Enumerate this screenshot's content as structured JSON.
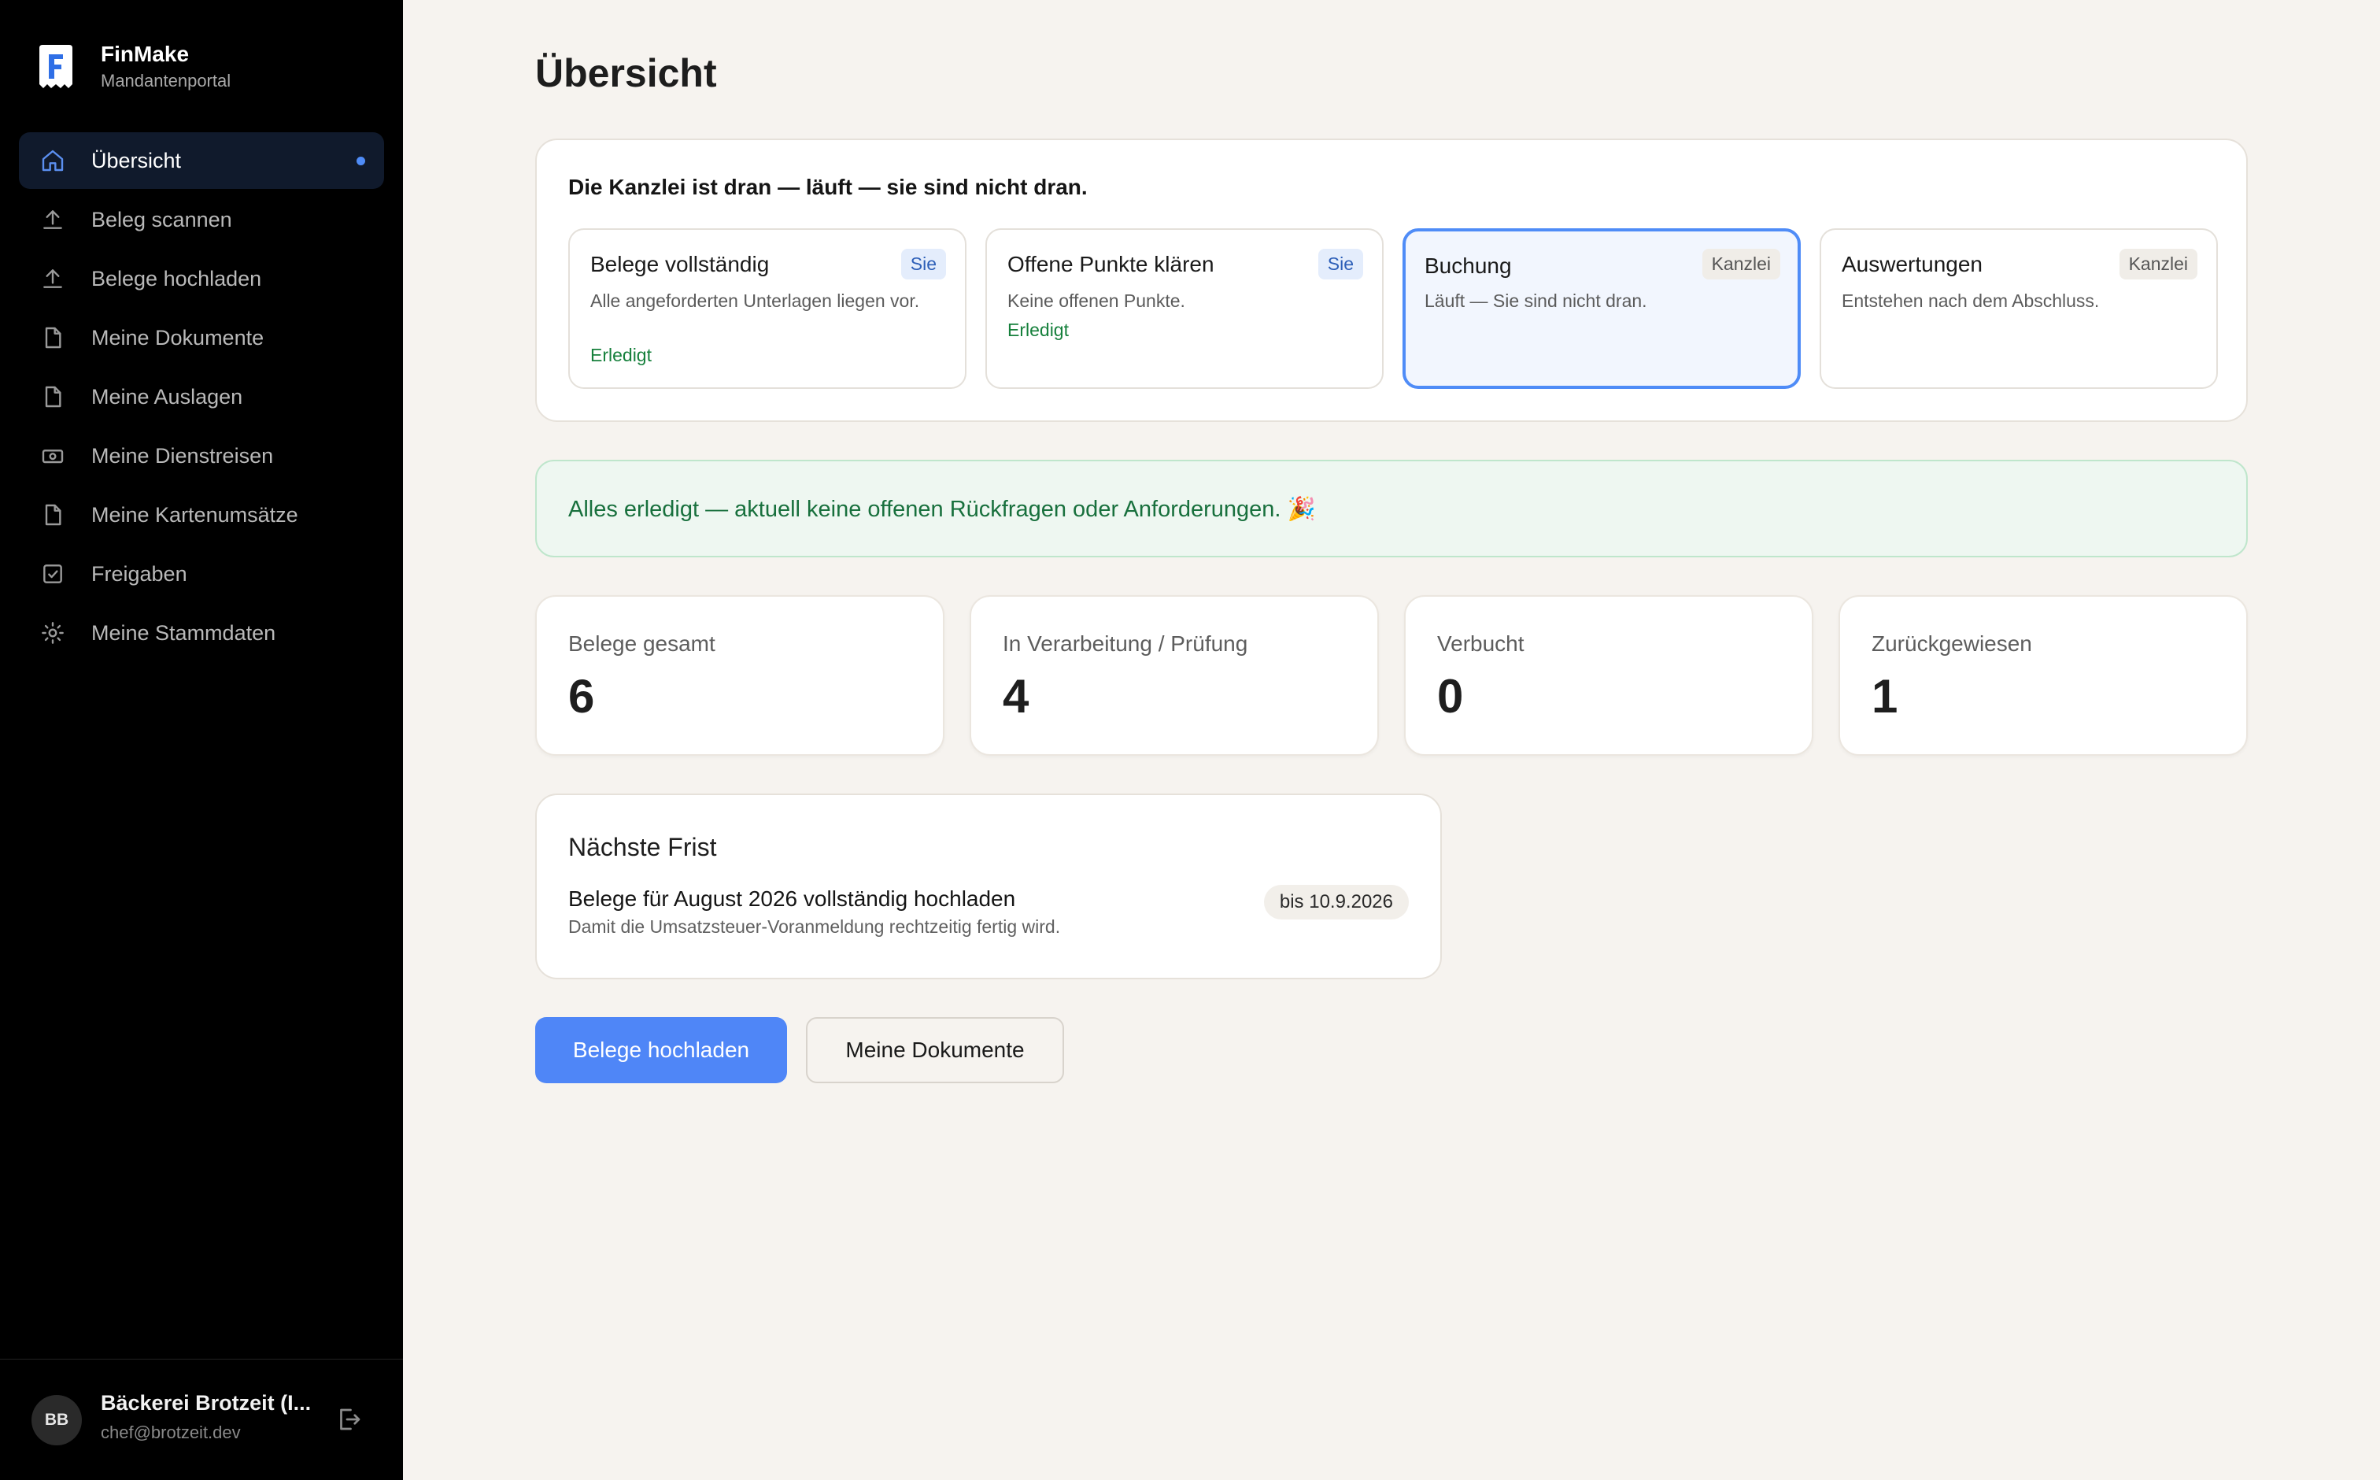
{
  "brand": {
    "name": "FinMake",
    "subtitle": "Mandantenportal"
  },
  "sidebar": {
    "items": [
      {
        "label": "Übersicht",
        "icon": "home-icon",
        "active": true
      },
      {
        "label": "Beleg scannen",
        "icon": "upload-icon"
      },
      {
        "label": "Belege hochladen",
        "icon": "upload-icon"
      },
      {
        "label": "Meine Dokumente",
        "icon": "document-icon"
      },
      {
        "label": "Meine Auslagen",
        "icon": "document-icon"
      },
      {
        "label": "Meine Dienstreisen",
        "icon": "banknote-icon"
      },
      {
        "label": "Meine Kartenumsätze",
        "icon": "document-icon"
      },
      {
        "label": "Freigaben",
        "icon": "checkbox-icon"
      },
      {
        "label": "Meine Stammdaten",
        "icon": "gear-icon"
      }
    ]
  },
  "user": {
    "initials": "BB",
    "name": "Bäckerei Brotzeit (I...",
    "email": "chef@brotzeit.dev"
  },
  "page": {
    "title": "Übersicht"
  },
  "status": {
    "heading": "Die Kanzlei ist dran — läuft — sie sind nicht dran.",
    "steps": [
      {
        "title": "Belege vollständig",
        "badge": "Sie",
        "desc": "Alle angeforderten Unterlagen liegen vor.",
        "state": "Erledigt"
      },
      {
        "title": "Offene Punkte klären",
        "badge": "Sie",
        "desc": "Keine offenen Punkte.",
        "state": "Erledigt"
      },
      {
        "title": "Buchung",
        "badge": "Kanzlei",
        "desc": "Läuft — Sie sind nicht dran.",
        "current": true
      },
      {
        "title": "Auswertungen",
        "badge": "Kanzlei",
        "desc": "Entstehen nach dem Abschluss."
      }
    ]
  },
  "banner": {
    "text": "Alles erledigt — aktuell keine offenen Rückfragen oder Anforderungen. 🎉"
  },
  "kpis": [
    {
      "label": "Belege gesamt",
      "value": "6"
    },
    {
      "label": "In Verarbeitung / Prüfung",
      "value": "4"
    },
    {
      "label": "Verbucht",
      "value": "0"
    },
    {
      "label": "Zurückgewiesen",
      "value": "1"
    }
  ],
  "deadline": {
    "heading": "Nächste Frist",
    "title": "Belege für August 2026 vollständig hochladen",
    "desc": "Damit die Umsatzsteuer-Voranmeldung rechtzeitig fertig wird.",
    "due": "bis 10.9.2026"
  },
  "actions": {
    "primary": "Belege hochladen",
    "secondary": "Meine Dokumente"
  },
  "colors": {
    "accent": "#4f86f7",
    "success": "#16803c",
    "sidebar_bg": "#000000",
    "page_bg": "#f6f3ef"
  }
}
